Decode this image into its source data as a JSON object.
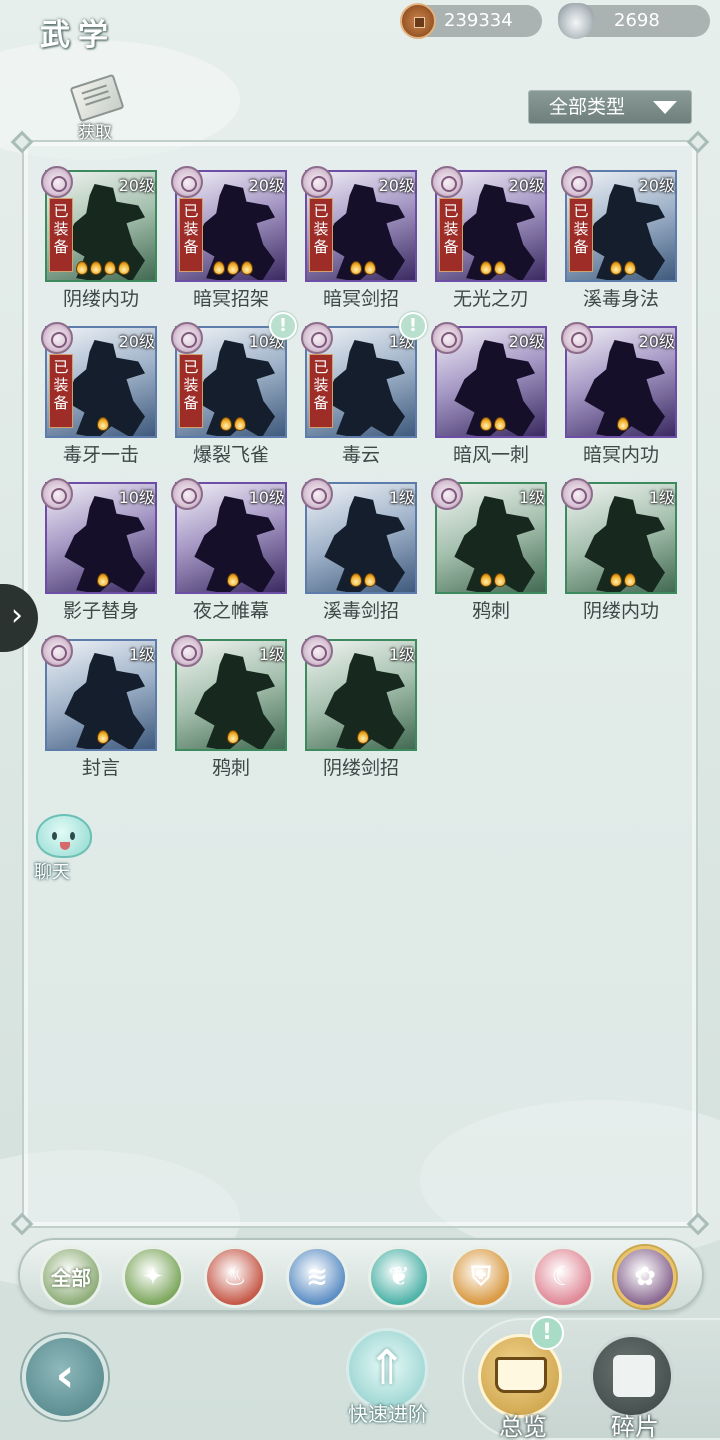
{
  "header": {
    "title": "武学",
    "coins": "239334",
    "silver": "2698"
  },
  "get_button": {
    "label": "获取"
  },
  "filter": {
    "label": "全部类型"
  },
  "skills": [
    {
      "name": "阴缕内功",
      "level": "20级",
      "equipped": true,
      "equipped_label": "已装备",
      "stars": 4,
      "color": "green",
      "alert": false
    },
    {
      "name": "暗冥招架",
      "level": "20级",
      "equipped": true,
      "equipped_label": "已装备",
      "stars": 3,
      "color": "purple",
      "alert": false
    },
    {
      "name": "暗冥剑招",
      "level": "20级",
      "equipped": true,
      "equipped_label": "已装备",
      "stars": 2,
      "color": "purple",
      "alert": false
    },
    {
      "name": "无光之刃",
      "level": "20级",
      "equipped": true,
      "equipped_label": "已装备",
      "stars": 2,
      "color": "purple",
      "alert": false
    },
    {
      "name": "溪毒身法",
      "level": "20级",
      "equipped": true,
      "equipped_label": "已装备",
      "stars": 2,
      "color": "blue",
      "alert": false
    },
    {
      "name": "毒牙一击",
      "level": "20级",
      "equipped": true,
      "equipped_label": "已装备",
      "stars": 1,
      "color": "blue",
      "alert": false
    },
    {
      "name": "爆裂飞雀",
      "level": "10级",
      "equipped": true,
      "equipped_label": "已装备",
      "stars": 2,
      "color": "blue",
      "alert": true
    },
    {
      "name": "毒云",
      "level": "1级",
      "equipped": true,
      "equipped_label": "已装备",
      "stars": 0,
      "color": "blue",
      "alert": true
    },
    {
      "name": "暗风一刺",
      "level": "20级",
      "equipped": false,
      "equipped_label": "",
      "stars": 2,
      "color": "purple",
      "alert": false
    },
    {
      "name": "暗冥内功",
      "level": "20级",
      "equipped": false,
      "equipped_label": "",
      "stars": 1,
      "color": "purple",
      "alert": false
    },
    {
      "name": "影子替身",
      "level": "10级",
      "equipped": false,
      "equipped_label": "",
      "stars": 1,
      "color": "purple",
      "alert": false
    },
    {
      "name": "夜之帷幕",
      "level": "10级",
      "equipped": false,
      "equipped_label": "",
      "stars": 1,
      "color": "purple",
      "alert": false
    },
    {
      "name": "溪毒剑招",
      "level": "1级",
      "equipped": false,
      "equipped_label": "",
      "stars": 2,
      "color": "blue",
      "alert": false
    },
    {
      "name": "鸦刺",
      "level": "1级",
      "equipped": false,
      "equipped_label": "",
      "stars": 2,
      "color": "green",
      "alert": false
    },
    {
      "name": "阴缕内功",
      "level": "1级",
      "equipped": false,
      "equipped_label": "",
      "stars": 2,
      "color": "green",
      "alert": false
    },
    {
      "name": "封言",
      "level": "1级",
      "equipped": false,
      "equipped_label": "",
      "stars": 1,
      "color": "blue",
      "alert": false
    },
    {
      "name": "鸦刺",
      "level": "1级",
      "equipped": false,
      "equipped_label": "",
      "stars": 1,
      "color": "green",
      "alert": false
    },
    {
      "name": "阴缕剑招",
      "level": "1级",
      "equipped": false,
      "equipped_label": "",
      "stars": 1,
      "color": "green",
      "alert": false
    }
  ],
  "chat": {
    "label": "聊天"
  },
  "element_tabs": [
    {
      "label": "全部",
      "icon": "all-text-icon",
      "color": "#8fae79",
      "selected": false
    },
    {
      "label": "",
      "icon": "wind-leaf-icon",
      "color": "#7ea85f",
      "selected": false
    },
    {
      "label": "",
      "icon": "fire-icon",
      "color": "#c65a4a",
      "selected": false
    },
    {
      "label": "",
      "icon": "wave-icon",
      "color": "#5d8fc4",
      "selected": false
    },
    {
      "label": "",
      "icon": "butterfly-icon",
      "color": "#4fb3a8",
      "selected": false
    },
    {
      "label": "",
      "icon": "shield-icon",
      "color": "#d99a43",
      "selected": false
    },
    {
      "label": "",
      "icon": "moon-icon",
      "color": "#e08a98",
      "selected": false
    },
    {
      "label": "",
      "icon": "rose-icon",
      "color": "#8b6a92",
      "selected": true
    }
  ],
  "bottom": {
    "quick_advance": "快速进阶",
    "overview": "总览",
    "fragments": "碎片"
  }
}
